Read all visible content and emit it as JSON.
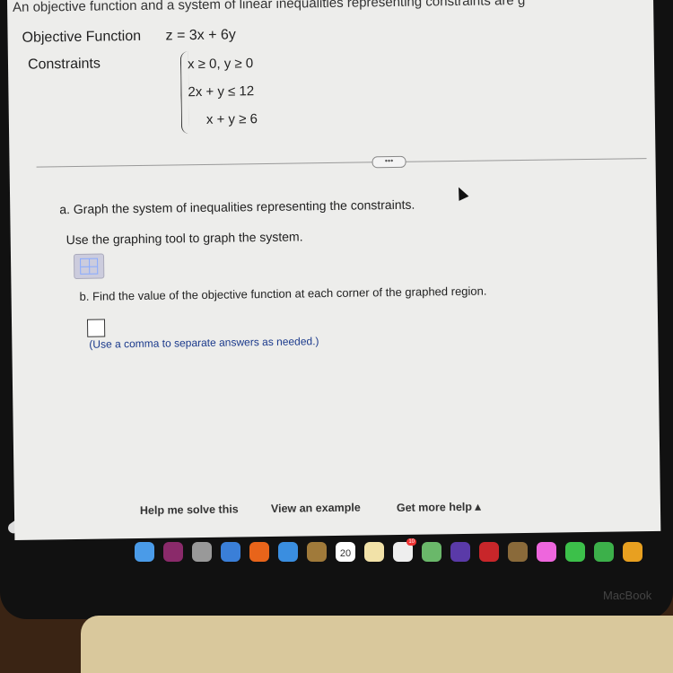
{
  "problem": {
    "intro": "An objective function and a system of linear inequalities representing constraints are g",
    "objective_label": "Objective Function",
    "objective": "z = 3x + 6y",
    "constraints_label": "Constraints",
    "constraints": [
      "x ≥ 0, y ≥ 0",
      "2x + y ≤ 12",
      "x + y ≥ 6"
    ]
  },
  "more_button": "•••",
  "part_a": {
    "question": "a. Graph the system of inequalities representing the constraints.",
    "instruction": "Use the graphing tool to graph the system."
  },
  "part_b": {
    "question": "b. Find the value of the objective function at each corner of the graphed region.",
    "hint": "(Use a comma to separate answers as needed.)"
  },
  "footer": {
    "help": "Help me solve this",
    "example": "View an example",
    "more": "Get more help ▴"
  },
  "dock": {
    "calendar_day": "20",
    "reminders_badge": "10",
    "apps": [
      "finder",
      "siri",
      "launchpad",
      "safari",
      "firefox",
      "mail",
      "contacts",
      "calendar",
      "notes",
      "reminders",
      "maps",
      "imovie",
      "photo-booth",
      "instruments",
      "photos",
      "messages",
      "facetime",
      "pages"
    ]
  },
  "brand": "MacBook"
}
